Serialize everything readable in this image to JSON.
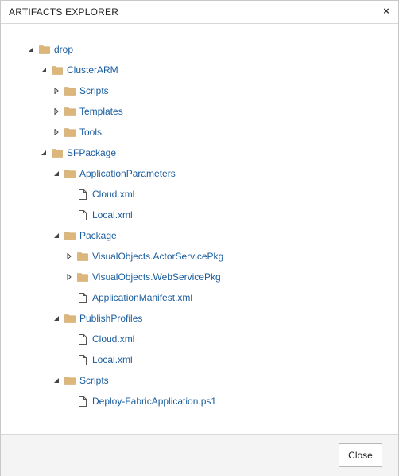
{
  "dialog": {
    "title": "ARTIFACTS EXPLORER",
    "close_icon": "×",
    "close_button_label": "Close"
  },
  "tree": [
    {
      "label": "drop",
      "type": "folder",
      "expanded": true,
      "depth": 0
    },
    {
      "label": "ClusterARM",
      "type": "folder",
      "expanded": true,
      "depth": 1
    },
    {
      "label": "Scripts",
      "type": "folder",
      "expanded": false,
      "depth": 2
    },
    {
      "label": "Templates",
      "type": "folder",
      "expanded": false,
      "depth": 2
    },
    {
      "label": "Tools",
      "type": "folder",
      "expanded": false,
      "depth": 2
    },
    {
      "label": "SFPackage",
      "type": "folder",
      "expanded": true,
      "depth": 1
    },
    {
      "label": "ApplicationParameters",
      "type": "folder",
      "expanded": true,
      "depth": 2
    },
    {
      "label": "Cloud.xml",
      "type": "file",
      "depth": 3
    },
    {
      "label": "Local.xml",
      "type": "file",
      "depth": 3
    },
    {
      "label": "Package",
      "type": "folder",
      "expanded": true,
      "depth": 2
    },
    {
      "label": "VisualObjects.ActorServicePkg",
      "type": "folder",
      "expanded": false,
      "depth": 3
    },
    {
      "label": "VisualObjects.WebServicePkg",
      "type": "folder",
      "expanded": false,
      "depth": 3
    },
    {
      "label": "ApplicationManifest.xml",
      "type": "file",
      "depth": 3
    },
    {
      "label": "PublishProfiles",
      "type": "folder",
      "expanded": true,
      "depth": 2
    },
    {
      "label": "Cloud.xml",
      "type": "file",
      "depth": 3
    },
    {
      "label": "Local.xml",
      "type": "file",
      "depth": 3
    },
    {
      "label": "Scripts",
      "type": "folder",
      "expanded": true,
      "depth": 2
    },
    {
      "label": "Deploy-FabricApplication.ps1",
      "type": "file",
      "depth": 3
    }
  ],
  "icons": {
    "folder": "folder-icon",
    "file": "file-icon",
    "expanded": "triangle-down-icon",
    "collapsed": "triangle-right-icon"
  },
  "colors": {
    "link": "#1a5d9e",
    "folder": "#dcb67a",
    "arrow": "#444444"
  }
}
